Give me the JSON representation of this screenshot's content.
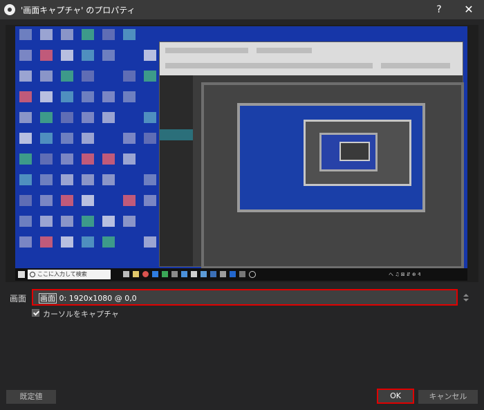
{
  "window": {
    "title": "'画面キャプチャ' のプロパティ",
    "help_label": "?",
    "close_label": "✕",
    "logo_icon": "obs-logo-icon"
  },
  "preview": {
    "taskbar_search_text": "ここに入力して検索",
    "taskbar_tray_text": "へ ♫ ⊠ ⇵ ⊕ ₰"
  },
  "screen": {
    "label": "画面",
    "value_prefix": "画面",
    "value_rest": " 0: 1920x1080 @ 0,0"
  },
  "capture_cursor": {
    "label": "カーソルをキャプチャ",
    "checked": true
  },
  "buttons": {
    "defaults": "既定値",
    "ok": "OK",
    "cancel": "キャンセル"
  },
  "colors": {
    "highlight": "#e00000",
    "background": "#252526",
    "desktop_blue": "#1636a8"
  }
}
